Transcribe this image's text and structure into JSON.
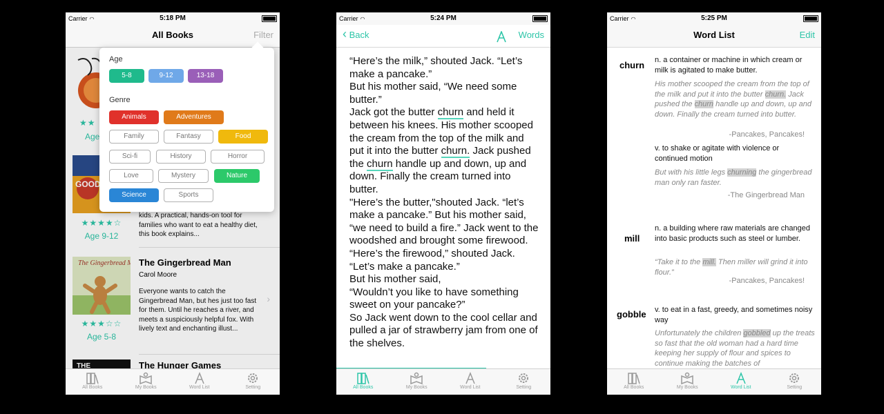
{
  "phone1": {
    "status": {
      "carrier": "Carrier",
      "time": "5:18 PM"
    },
    "nav": {
      "title": "All Books",
      "filter": "Filter"
    },
    "books": [
      {
        "title": "",
        "author": "",
        "description": "",
        "stars": "★★",
        "age": "Age"
      },
      {
        "title": "",
        "author": "",
        "description": "kids. A practical, hands-on tool for families who want to eat a healthy diet, this book explains...",
        "stars": "★★★★☆",
        "age": "Age 9-12"
      },
      {
        "title": "The Gingerbread Man",
        "author": "Carol Moore",
        "description": "Everyone wants to catch the Gingerbread Man, but hes just too fast for them. Until he reaches a river, and meets a suspiciously helpful fox. With lively text and enchanting illust...",
        "stars": "★★★☆☆",
        "age": "Age 5-8"
      },
      {
        "title": "The Hunger Games",
        "author": "",
        "description": "",
        "stars": "",
        "age": ""
      }
    ],
    "covers": {
      "book1_text": "",
      "book2_text": "GOOD",
      "book3_text": "The Gingerbread Man",
      "book4_text": "THE"
    },
    "filter": {
      "age_label": "Age",
      "age_options": [
        "5-8",
        "9-12",
        "13-18"
      ],
      "genre_label": "Genre",
      "genres": [
        "Animals",
        "Adventures",
        "Family",
        "Fantasy",
        "Food",
        "Sci-fi",
        "History",
        "Horror",
        "Love",
        "Mystery",
        "Nature",
        "Science",
        "Sports"
      ]
    },
    "tabs": [
      "All Books",
      "My Books",
      "Word List",
      "Setting"
    ]
  },
  "phone2": {
    "status": {
      "carrier": "Carrier",
      "time": "5:24 PM"
    },
    "nav": {
      "back": "Back",
      "words": "Words"
    },
    "text": {
      "l1": "“Here’s the milk,” shouted Jack. “Let’s make a pancake.”",
      "l2": "But his mother said, “We need some butter.”",
      "l3a": "Jack got the butter ",
      "churn": "churn",
      "l3b": " and held it between his knees. His mother scooped the cream from the top of the milk and put it into the butter ",
      "churn_dot": "churn.",
      "l3c": " Jack pushed the ",
      "l3d": " handle up and down, up and down. Finally the cream turned into butter.",
      "l4": "\"Here’s the butter,\"shouted Jack. “let’s make a pancake.” But his mother said, “we need to build a fire.” Jack went to the woodshed and brought some firewood.",
      "l5": "“Here’s the firewood,” shouted Jack. “Let’s make a pancake.”",
      "l6": "But his mother said,",
      "l7": "“Wouldn’t you like to have something sweet on your pancake?”",
      "l8": "So Jack went down to the cool cellar and pulled a jar of strawberry jam from one of the shelves."
    },
    "reading_progress": 0.7,
    "tabs": [
      "All Books",
      "My Books",
      "Word List",
      "Setting"
    ]
  },
  "phone3": {
    "status": {
      "carrier": "Carrier",
      "time": "5:25 PM"
    },
    "nav": {
      "title": "Word List",
      "edit": "Edit"
    },
    "entries": {
      "churn": {
        "word": "churn",
        "def1": "n. a container or machine in which cream or milk is agitated to make butter.",
        "ex1a": "His mother scooped the cream from the top of the milk and put it into the butter ",
        "ex1h": "churn.",
        "ex1b": " Jack pushed the ",
        "ex1h2": "churn",
        "ex1c": " handle up and down, up and down. Finally the cream turned into butter.",
        "src1": "-Pancakes, Pancakes!",
        "def2": "v. to shake or agitate with violence or continued motion",
        "ex2a": "But with his little legs ",
        "ex2h": "churning",
        "ex2b": " the gingerbread man only ran faster.",
        "src2": "-The Gingerbread Man"
      },
      "mill": {
        "word": "mill",
        "def1": "n. a building where raw materials are changed into basic products such as steel or lumber.",
        "ex1a": "“Take it to the ",
        "ex1h": "mill.",
        "ex1b": " Then miller will grind it into flour.”",
        "src1": "-Pancakes, Pancakes!"
      },
      "gobble": {
        "word": "gobble",
        "def1": "v. to eat in a fast, greedy, and sometimes noisy way",
        "ex1a": "Unfortunately the children ",
        "ex1h": "gobbled",
        "ex1b": " up the treats so fast that the old woman had a hard time keeping her supply of flour and spices to continue making the batches of"
      }
    },
    "tabs": [
      "All Books",
      "My Books",
      "Word List",
      "Setting"
    ]
  },
  "colors": {
    "accent": "#2dc5a8",
    "age_5_8": "#1fba8c",
    "age_9_12": "#6fa8e8",
    "age_13_18": "#9a5fb8",
    "animals": "#e0312b",
    "adventures": "#e07a1a",
    "food": "#f0b90d",
    "nature": "#2cc96a",
    "science": "#2a86d6"
  }
}
